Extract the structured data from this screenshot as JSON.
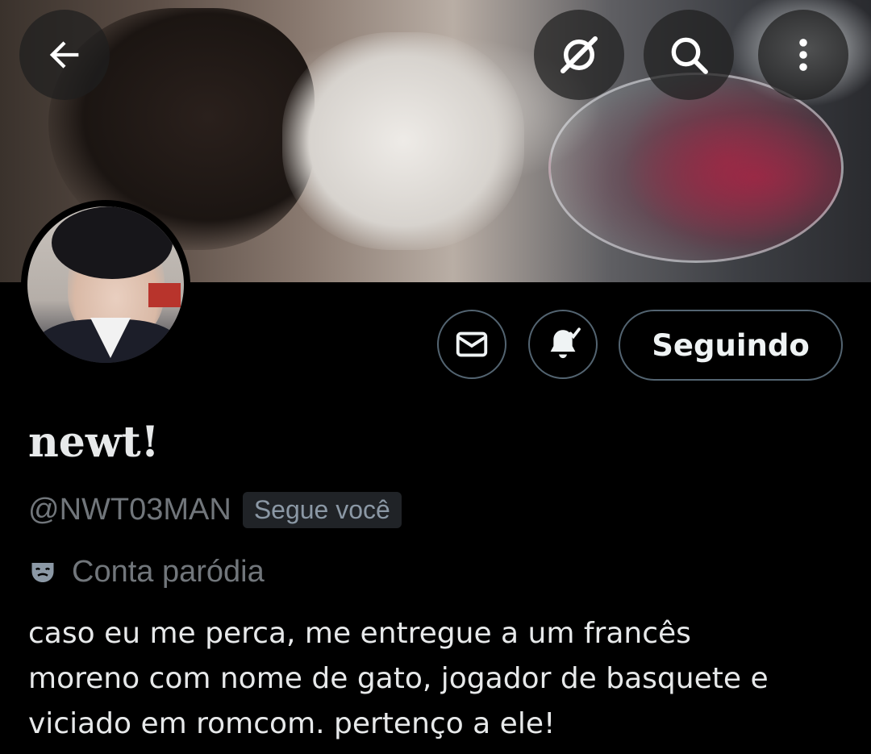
{
  "header": {
    "back_icon": "arrow-left-icon",
    "grok_icon": "grok-slash-icon",
    "search_icon": "search-icon",
    "more_icon": "more-vertical-icon"
  },
  "profile": {
    "display_name": "newt!",
    "handle": "@NWT03MAN",
    "follows_you_badge": "Segue você",
    "parody_label": "Conta paródia",
    "parody_icon": "theater-mask-icon",
    "bio_lines": [
      "caso eu me perca, me entregue a um francês",
      "moreno com nome de gato, jogador de basquete e",
      "viciado em romcom. pertenço a ele!"
    ]
  },
  "actions": {
    "message_icon": "envelope-icon",
    "notifications_icon": "bell-check-icon",
    "follow_label": "Seguindo"
  },
  "colors": {
    "background": "#000000",
    "text_primary": "#e7e9ea",
    "text_secondary": "#71767b",
    "border": "#536471",
    "badge_bg": "#202327"
  }
}
